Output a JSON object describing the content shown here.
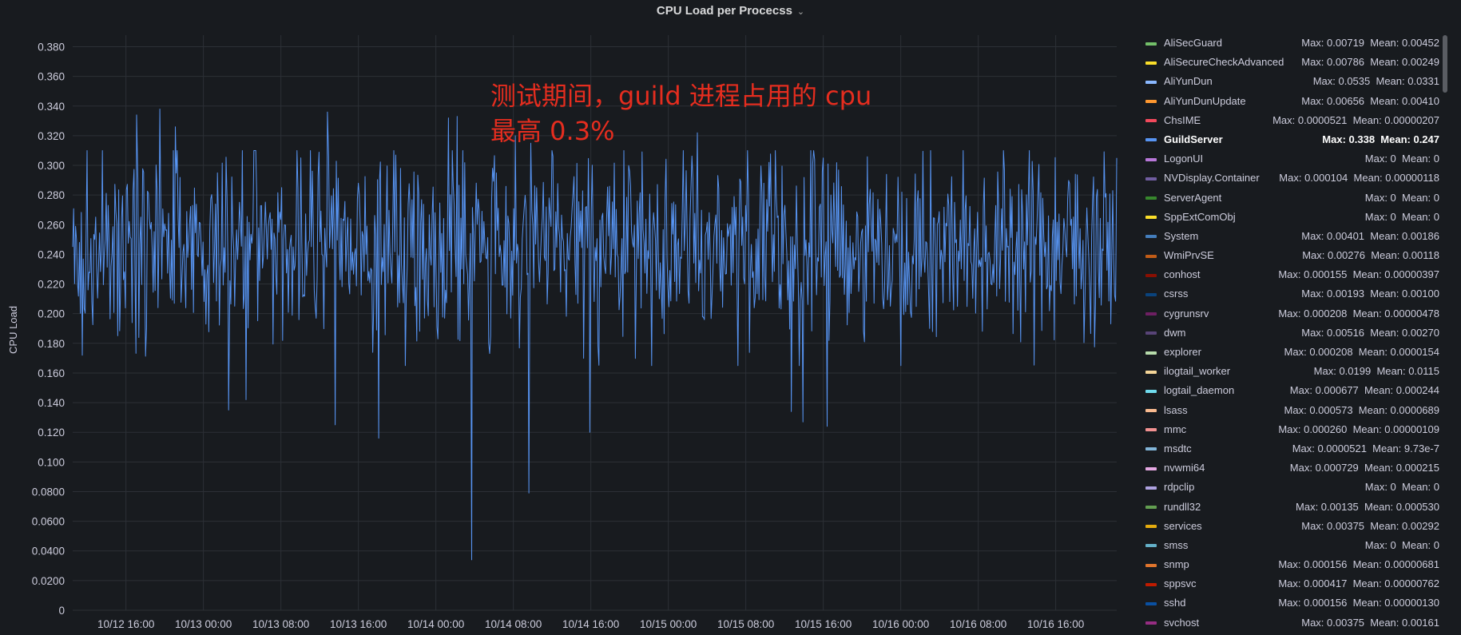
{
  "panel": {
    "title": "CPU Load per Procecss",
    "chevron": "⌄"
  },
  "chart_data": {
    "type": "line",
    "title": "CPU Load per Procecss",
    "ylabel": "CPU Load",
    "xlabel": "",
    "ylim": [
      0,
      0.39
    ],
    "grid": true,
    "legend_placement": "right",
    "y_ticks": [
      "0",
      "0.0200",
      "0.0400",
      "0.0600",
      "0.0800",
      "0.100",
      "0.120",
      "0.140",
      "0.160",
      "0.180",
      "0.200",
      "0.220",
      "0.240",
      "0.260",
      "0.280",
      "0.300",
      "0.320",
      "0.340",
      "0.360",
      "0.380"
    ],
    "y_tick_values": [
      0,
      0.02,
      0.04,
      0.06,
      0.08,
      0.1,
      0.12,
      0.14,
      0.16,
      0.18,
      0.2,
      0.22,
      0.24,
      0.26,
      0.28,
      0.3,
      0.32,
      0.34,
      0.36,
      0.38
    ],
    "x_ticks": [
      "10/12 16:00",
      "10/13 00:00",
      "10/13 08:00",
      "10/13 16:00",
      "10/14 00:00",
      "10/14 08:00",
      "10/14 16:00",
      "10/15 00:00",
      "10/15 08:00",
      "10/15 16:00",
      "10/16 00:00",
      "10/16 08:00",
      "10/16 16:00"
    ],
    "x_range_hours": [
      -5.5,
      102.3
    ],
    "series": [
      {
        "name": "GuildServer",
        "color": "#5794f2",
        "max": 0.338,
        "mean": 0.247,
        "min": 0.034,
        "points": [
          [
            -5.5,
            0.245
          ],
          [
            1.1,
            0.334
          ],
          [
            3.5,
            0.338
          ],
          [
            5.1,
            0.326
          ],
          [
            10.6,
            0.135
          ],
          [
            12.4,
            0.142
          ],
          [
            20.8,
            0.336
          ],
          [
            21.6,
            0.125
          ],
          [
            26.1,
            0.116
          ],
          [
            33.3,
            0.332
          ],
          [
            34.2,
            0.333
          ],
          [
            35.7,
            0.034
          ],
          [
            40.2,
            0.32
          ],
          [
            41.6,
            0.079
          ],
          [
            41.8,
            0.315
          ],
          [
            47.9,
            0.12
          ],
          [
            59.0,
            0.322
          ],
          [
            66.4,
            0.302
          ],
          [
            68.7,
            0.134
          ],
          [
            69.9,
            0.127
          ],
          [
            72.0,
            0.305
          ],
          [
            72.4,
            0.124
          ],
          [
            102.3,
            0.305
          ]
        ]
      }
    ],
    "annotations": [
      "测试期间，guild 进程占用的 cpu",
      "最高 0.3%"
    ]
  },
  "legend": [
    {
      "name": "AliSecGuard",
      "color": "#73bf69",
      "max": "Max: 0.00719",
      "mean": "Mean: 0.00452"
    },
    {
      "name": "AliSecureCheckAdvanced",
      "color": "#fade2a",
      "max": "Max: 0.00786",
      "mean": "Mean: 0.00249"
    },
    {
      "name": "AliYunDun",
      "color": "#8ab8ff",
      "max": "Max: 0.0535",
      "mean": "Mean: 0.0331"
    },
    {
      "name": "AliYunDunUpdate",
      "color": "#ff9830",
      "max": "Max: 0.00656",
      "mean": "Mean: 0.00410"
    },
    {
      "name": "ChsIME",
      "color": "#f2495c",
      "max": "Max: 0.0000521",
      "mean": "Mean: 0.00000207"
    },
    {
      "name": "GuildServer",
      "color": "#5794f2",
      "max": "Max: 0.338",
      "mean": "Mean: 0.247",
      "active": true
    },
    {
      "name": "LogonUI",
      "color": "#b877d9",
      "max": "Max: 0",
      "mean": "Mean: 0"
    },
    {
      "name": "NVDisplay.Container",
      "color": "#705da0",
      "max": "Max: 0.000104",
      "mean": "Mean: 0.00000118"
    },
    {
      "name": "ServerAgent",
      "color": "#37872d",
      "max": "Max: 0",
      "mean": "Mean: 0"
    },
    {
      "name": "SppExtComObj",
      "color": "#fade2a",
      "max": "Max: 0",
      "mean": "Mean: 0"
    },
    {
      "name": "System",
      "color": "#447ebc",
      "max": "Max: 0.00401",
      "mean": "Mean: 0.00186"
    },
    {
      "name": "WmiPrvSE",
      "color": "#c15c17",
      "max": "Max: 0.00276",
      "mean": "Mean: 0.00118"
    },
    {
      "name": "conhost",
      "color": "#890f02",
      "max": "Max: 0.000155",
      "mean": "Mean: 0.00000397"
    },
    {
      "name": "csrss",
      "color": "#0a437c",
      "max": "Max: 0.00193",
      "mean": "Mean: 0.00100"
    },
    {
      "name": "cygrunsrv",
      "color": "#6d1f62",
      "max": "Max: 0.000208",
      "mean": "Mean: 0.00000478"
    },
    {
      "name": "dwm",
      "color": "#584477",
      "max": "Max: 0.00516",
      "mean": "Mean: 0.00270"
    },
    {
      "name": "explorer",
      "color": "#b7dbab",
      "max": "Max: 0.000208",
      "mean": "Mean: 0.0000154"
    },
    {
      "name": "ilogtail_worker",
      "color": "#f4d598",
      "max": "Max: 0.0199",
      "mean": "Mean: 0.0115"
    },
    {
      "name": "logtail_daemon",
      "color": "#70dbed",
      "max": "Max: 0.000677",
      "mean": "Mean: 0.000244"
    },
    {
      "name": "lsass",
      "color": "#f9ba8f",
      "max": "Max: 0.000573",
      "mean": "Mean: 0.0000689"
    },
    {
      "name": "mmc",
      "color": "#f29191",
      "max": "Max: 0.000260",
      "mean": "Mean: 0.00000109"
    },
    {
      "name": "msdtc",
      "color": "#82b5d8",
      "max": "Max: 0.0000521",
      "mean": "Mean: 9.73e-7"
    },
    {
      "name": "nvwmi64",
      "color": "#e5a8e2",
      "max": "Max: 0.000729",
      "mean": "Mean: 0.000215"
    },
    {
      "name": "rdpclip",
      "color": "#aea2e0",
      "max": "Max: 0",
      "mean": "Mean: 0"
    },
    {
      "name": "rundll32",
      "color": "#629e51",
      "max": "Max: 0.00135",
      "mean": "Mean: 0.000530"
    },
    {
      "name": "services",
      "color": "#e5ac0e",
      "max": "Max: 0.00375",
      "mean": "Mean: 0.00292"
    },
    {
      "name": "smss",
      "color": "#64b0c8",
      "max": "Max: 0",
      "mean": "Mean: 0"
    },
    {
      "name": "snmp",
      "color": "#e0752d",
      "max": "Max: 0.000156",
      "mean": "Mean: 0.00000681"
    },
    {
      "name": "sppsvc",
      "color": "#bf1b00",
      "max": "Max: 0.000417",
      "mean": "Mean: 0.00000762"
    },
    {
      "name": "sshd",
      "color": "#0a50a1",
      "max": "Max: 0.000156",
      "mean": "Mean: 0.00000130"
    },
    {
      "name": "svchost",
      "color": "#962d82",
      "max": "Max: 0.00375",
      "mean": "Mean: 0.00161"
    }
  ]
}
